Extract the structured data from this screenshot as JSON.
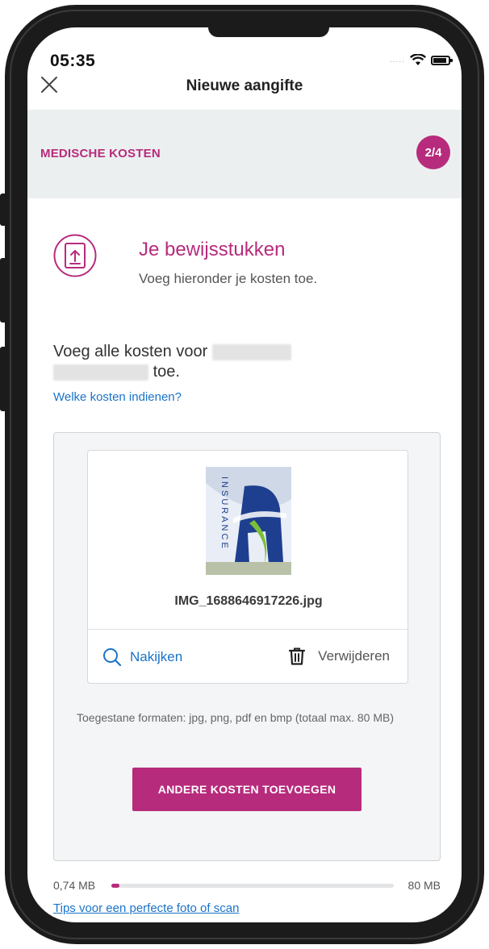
{
  "status_bar": {
    "time": "05:35",
    "signal_dots": "....."
  },
  "header": {
    "title": "Nieuwe aangifte"
  },
  "step": {
    "label": "MEDISCHE KOSTEN",
    "badge": "2/4"
  },
  "section": {
    "title": "Je bewijsstukken",
    "subtitle": "Voeg hieronder je kosten toe."
  },
  "instruction": {
    "line1_prefix": "Voeg alle kosten voor",
    "line2_suffix": "toe."
  },
  "help_link": "Welke kosten indienen?",
  "file": {
    "name": "IMG_1688646917226.jpg",
    "thumbnail_text": "INSURANCE",
    "review_label": "Nakijken",
    "delete_label": "Verwijderen"
  },
  "formats_note": "Toegestane formaten: jpg, png, pdf en bmp (totaal max. 80 MB)",
  "add_button_label": "ANDERE KOSTEN TOEVOEGEN",
  "storage": {
    "used": "0,74 MB",
    "max": "80 MB",
    "used_fraction": 0.00925
  },
  "tips_link": "Tips voor een perfecte foto of scan",
  "colors": {
    "accent": "#b72b7c",
    "link": "#1a73c8",
    "step_bar_bg": "#eceff0"
  },
  "icons": {
    "close": "close-icon",
    "wifi": "wifi-icon",
    "battery": "battery-icon",
    "upload": "upload-document-icon",
    "search": "search-icon",
    "trash": "trash-icon"
  }
}
